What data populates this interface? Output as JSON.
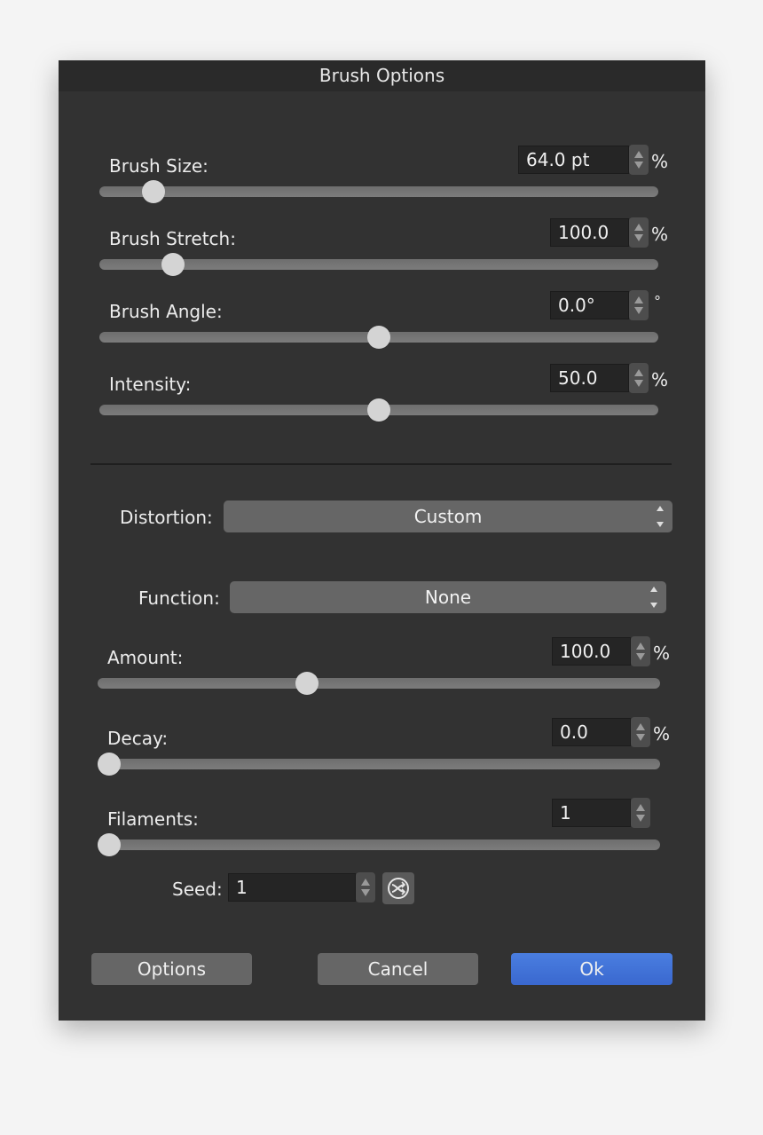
{
  "dialog": {
    "title": "Brush Options"
  },
  "brush_section": [
    {
      "label": "Brush Size:",
      "value": "64.0 pt",
      "unit": "%",
      "slider_fraction": 0.08
    },
    {
      "label": "Brush Stretch:",
      "value": "100.0",
      "unit": "%",
      "slider_fraction": 0.116
    },
    {
      "label": "Brush Angle:",
      "value": "0.0°",
      "unit": "°",
      "slider_fraction": 0.5
    },
    {
      "label": "Intensity:",
      "value": "50.0",
      "unit": "%",
      "slider_fraction": 0.5
    }
  ],
  "distortion": {
    "label": "Distortion:",
    "selected": "Custom"
  },
  "function": {
    "label": "Function:",
    "selected": "None"
  },
  "distortion_section": [
    {
      "label": "Amount:",
      "value": "100.0",
      "unit": "%",
      "slider_fraction": 0.366
    },
    {
      "label": "Decay:",
      "value": "0.0",
      "unit": "%",
      "slider_fraction": 0.0
    },
    {
      "label": "Filaments:",
      "value": "1",
      "unit": "",
      "slider_fraction": 0.0
    }
  ],
  "seed": {
    "label": "Seed:",
    "value": "1",
    "randomize_icon": "shuffle-icon"
  },
  "buttons": {
    "options": "Options",
    "cancel": "Cancel",
    "ok": "Ok"
  },
  "colors": {
    "accent": "#3f72d8",
    "panel": "#323232",
    "titlebar": "#2a2a2a"
  }
}
